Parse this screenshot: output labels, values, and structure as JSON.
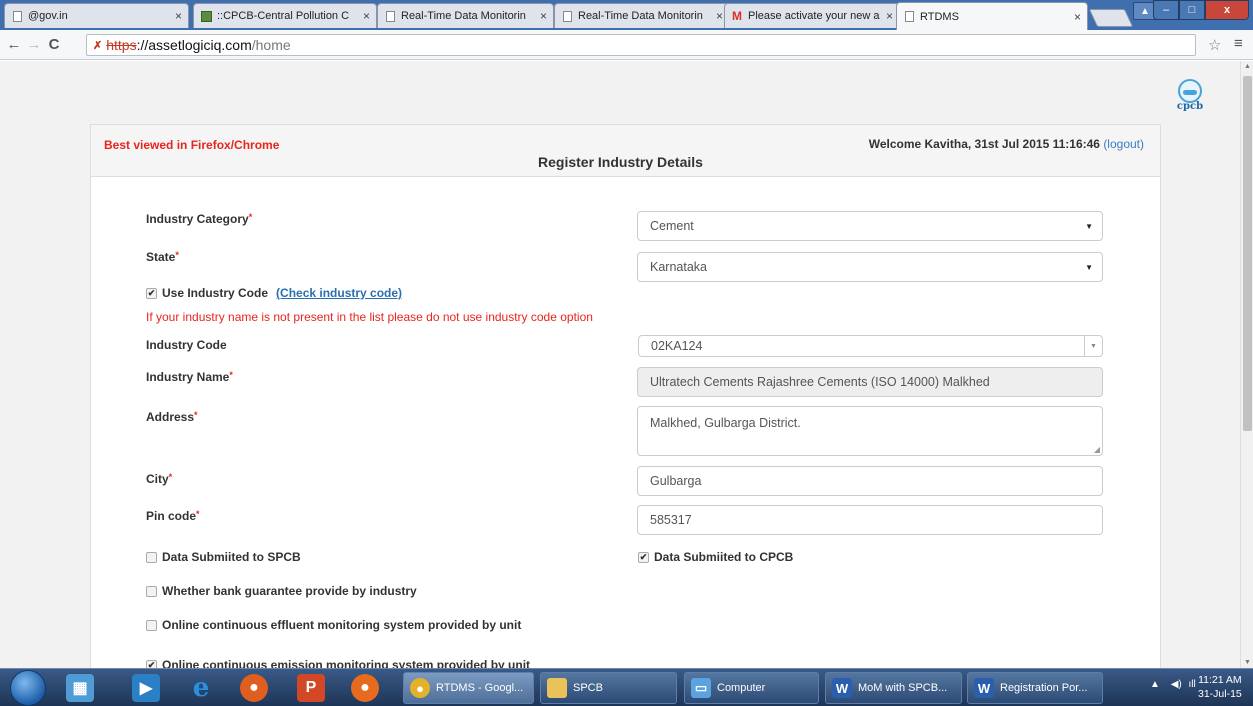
{
  "browser": {
    "tabs": [
      {
        "label": "@gov.in",
        "icon": "document-icon"
      },
      {
        "label": "::CPCB-Central Pollution C",
        "icon": "cpcb-favicon"
      },
      {
        "label": "Real-Time Data Monitorin",
        "icon": "document-icon"
      },
      {
        "label": "Real-Time Data Monitorin",
        "icon": "document-icon"
      },
      {
        "label": "Please activate your new a",
        "icon": "gmail-icon"
      },
      {
        "label": "RTDMS",
        "icon": "document-icon",
        "active": true
      }
    ],
    "url": {
      "scheme": "https",
      "host": "://assetlogiciq.com",
      "path": "/home"
    },
    "close_glyph": "×",
    "window_buttons": {
      "minimize": "–",
      "maximize": "□",
      "close": "x"
    }
  },
  "site": {
    "logo_text": "cpcb"
  },
  "header": {
    "notice": "Best viewed in Firefox/Chrome",
    "title": "Register Industry Details",
    "welcome": "Welcome Kavitha, 31st Jul 2015 11:16:46",
    "logout": "(logout)"
  },
  "form": {
    "required_mark": "*",
    "industry_category": {
      "label": "Industry Category",
      "value": "Cement"
    },
    "state": {
      "label": "State",
      "value": "Karnataka"
    },
    "use_industry_code": {
      "label": "Use Industry Code",
      "checked": true,
      "link": "(Check industry code)"
    },
    "warning": "If your industry name is not present in the list please do not use industry code option",
    "industry_code": {
      "label": "Industry Code",
      "value": "02KA124"
    },
    "industry_name": {
      "label": "Industry Name",
      "value": "Ultratech Cements Rajashree Cements (ISO 14000) Malkhed"
    },
    "address": {
      "label": "Address",
      "value": "Malkhed, Gulbarga District."
    },
    "city": {
      "label": "City",
      "value": "Gulbarga"
    },
    "pin_code": {
      "label": "Pin code",
      "value": "585317"
    },
    "data_spcb": {
      "label": "Data Submiited to SPCB",
      "checked": false
    },
    "data_cpcb": {
      "label": "Data Submiited to CPCB",
      "checked": true
    },
    "bank_guarantee": {
      "label": "Whether bank guarantee provide by industry",
      "checked": false
    },
    "effluent_monitoring": {
      "label": "Online continuous effluent monitoring system provided by unit",
      "checked": false
    },
    "emission_monitoring": {
      "label": "Online continuous emission monitoring system provided by unit",
      "checked": true
    }
  },
  "taskbar": {
    "apps": [
      {
        "label": "RTDMS - Googl...",
        "icon": "chrome-icon"
      },
      {
        "label": "SPCB",
        "icon": "folder-icon"
      },
      {
        "label": "Computer",
        "icon": "computer-icon"
      },
      {
        "label": "MoM with SPCB...",
        "icon": "word-icon"
      },
      {
        "label": "Registration Por...",
        "icon": "word-icon"
      }
    ],
    "time": "11:21 AM",
    "date": "31-Jul-15"
  }
}
